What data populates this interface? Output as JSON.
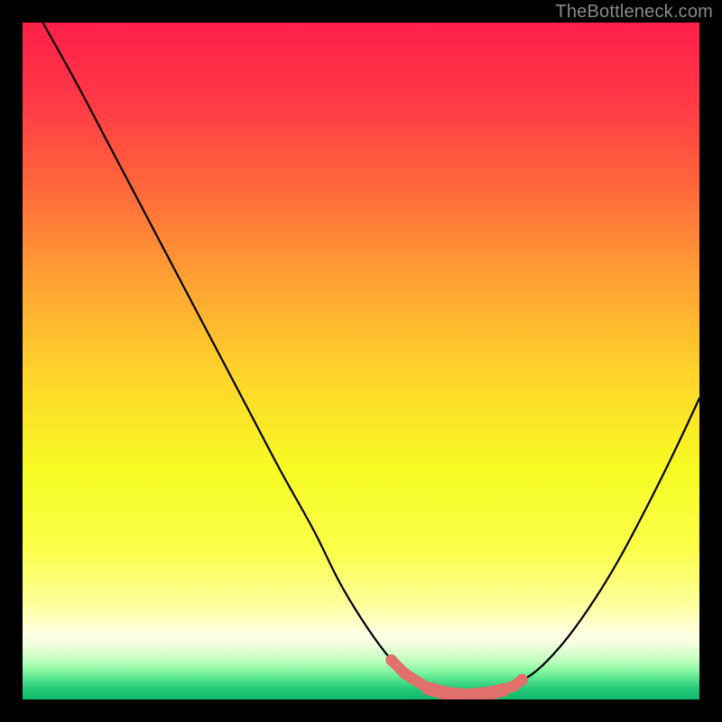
{
  "attribution": "TheBottleneck.com",
  "palette": {
    "black": "#000000",
    "curve": "#000000",
    "marker_fill": "#e16f6a",
    "gradient_stops": [
      {
        "offset": 0.0,
        "color": "#ff1f4a"
      },
      {
        "offset": 0.12,
        "color": "#ff3a46"
      },
      {
        "offset": 0.25,
        "color": "#ff6a3a"
      },
      {
        "offset": 0.38,
        "color": "#ffa133"
      },
      {
        "offset": 0.52,
        "color": "#ffd42a"
      },
      {
        "offset": 0.66,
        "color": "#f6fb23"
      },
      {
        "offset": 0.78,
        "color": "#fbff4a"
      },
      {
        "offset": 0.86,
        "color": "#fdff9c"
      },
      {
        "offset": 0.905,
        "color": "#ffffe6"
      },
      {
        "offset": 0.918,
        "color": "#f3ffe0"
      },
      {
        "offset": 0.93,
        "color": "#daffcf"
      },
      {
        "offset": 0.945,
        "color": "#b8febb"
      },
      {
        "offset": 0.958,
        "color": "#86f6a1"
      },
      {
        "offset": 0.972,
        "color": "#4fe08b"
      },
      {
        "offset": 0.985,
        "color": "#23c877"
      },
      {
        "offset": 1.0,
        "color": "#0fb86b"
      }
    ]
  },
  "chart_data": {
    "type": "line",
    "title": "",
    "xlabel": "",
    "ylabel": "",
    "xlim": [
      0,
      100
    ],
    "ylim": [
      0,
      100
    ],
    "grid": false,
    "legend": false,
    "series": [
      {
        "name": "bottleneck-curve",
        "x": [
          3,
          8,
          13,
          18,
          23,
          28,
          33,
          38,
          43,
          47,
          51,
          54.5,
          57,
          60,
          63,
          66,
          69,
          72,
          76,
          80,
          84,
          88,
          92,
          96,
          100
        ],
        "y": [
          100,
          91,
          81.5,
          72,
          62.5,
          53,
          43.5,
          34,
          25,
          17,
          10.5,
          5.8,
          3.3,
          1.6,
          0.8,
          0.6,
          0.9,
          1.8,
          4.3,
          8.5,
          14,
          20.5,
          28,
          36,
          44.5
        ]
      },
      {
        "name": "sweet-spot-markers",
        "x": [
          54.5,
          56.5,
          60,
          63,
          66,
          69,
          71,
          72.6,
          73.8
        ],
        "y": [
          5.8,
          3.8,
          1.6,
          0.8,
          0.6,
          0.9,
          1.4,
          2.0,
          2.9
        ]
      }
    ]
  }
}
